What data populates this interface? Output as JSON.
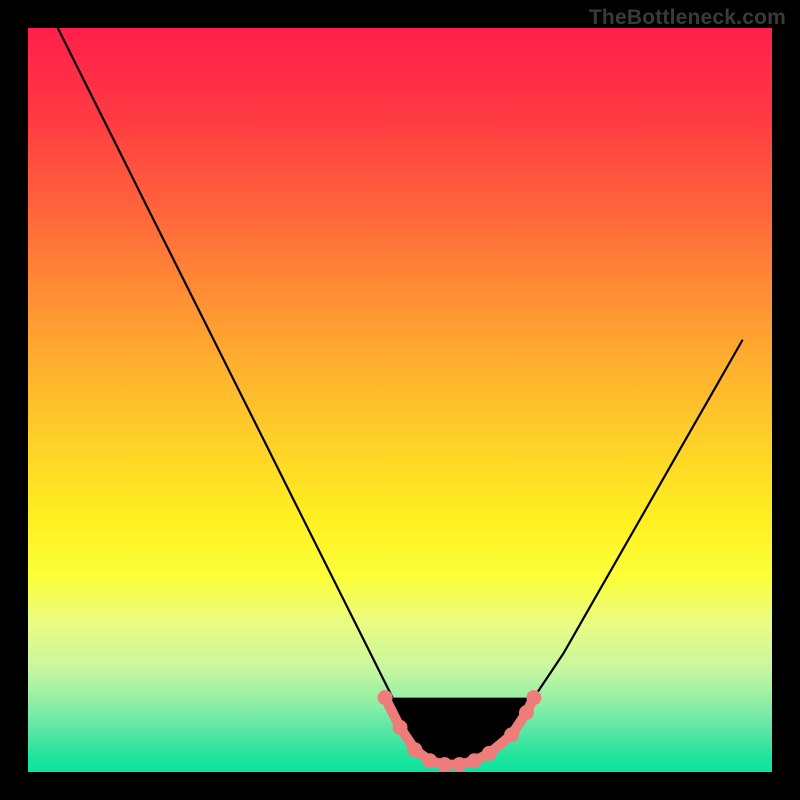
{
  "watermark": "TheBottleneck.com",
  "colors": {
    "marker": "#ed7c7b",
    "curve": "#000000",
    "frame": "#000000"
  },
  "chart_data": {
    "type": "line",
    "title": "",
    "xlabel": "",
    "ylabel": "",
    "xlim": [
      0,
      100
    ],
    "ylim": [
      0,
      100
    ],
    "grid": false,
    "series": [
      {
        "name": "bottleneck-curve",
        "x": [
          4,
          8,
          12,
          16,
          20,
          24,
          28,
          32,
          36,
          40,
          44,
          48,
          50,
          52,
          54,
          56,
          58,
          60,
          64,
          68,
          72,
          76,
          80,
          84,
          88,
          92,
          96
        ],
        "y": [
          100,
          92,
          84,
          76,
          68,
          60,
          52,
          44,
          36,
          28,
          20,
          12,
          8,
          4,
          2,
          1,
          1,
          2,
          5,
          10,
          16,
          23,
          30,
          37,
          44,
          51,
          58
        ]
      }
    ],
    "markers": {
      "name": "highlight-dots",
      "points": [
        {
          "x": 48,
          "y": 10
        },
        {
          "x": 50,
          "y": 6
        },
        {
          "x": 52,
          "y": 3
        },
        {
          "x": 54,
          "y": 1.5
        },
        {
          "x": 56,
          "y": 1
        },
        {
          "x": 58,
          "y": 1
        },
        {
          "x": 60,
          "y": 1.5
        },
        {
          "x": 62,
          "y": 2.5
        },
        {
          "x": 65,
          "y": 5
        },
        {
          "x": 67,
          "y": 8
        },
        {
          "x": 68,
          "y": 10
        }
      ]
    }
  }
}
